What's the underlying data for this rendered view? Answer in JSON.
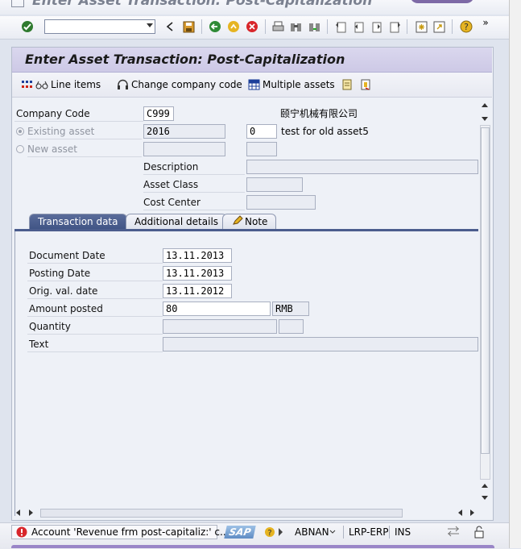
{
  "window": {
    "title": "Enter Asset Transaction: Post-Capitalization"
  },
  "toolbar": {
    "command_field_value": "",
    "icons": [
      "check-icon",
      "back-icon",
      "save-icon",
      "green-back-icon",
      "exit-icon",
      "cancel-icon",
      "print-icon",
      "find-icon",
      "find-next-icon",
      "first-page-icon",
      "prev-page-icon",
      "next-page-icon",
      "last-page-icon",
      "new-session-icon",
      "shortcut-icon",
      "help-icon",
      "more-icon"
    ]
  },
  "header": {
    "title": "Enter Asset Transaction: Post-Capitalization"
  },
  "app_toolbar": {
    "line_items": "Line items",
    "change_company_code": "Change company code",
    "multiple_assets": "Multiple assets"
  },
  "form": {
    "company_code_label": "Company Code",
    "company_code_value": "C999",
    "company_name": "颐宁机械有限公司",
    "existing_asset_label": "Existing asset",
    "existing_asset_value": "2016",
    "existing_asset_sub": "0",
    "existing_asset_text": "test for old asset5",
    "new_asset_label": "New asset",
    "new_asset_value": "",
    "new_asset_sub": "",
    "description_label": "Description",
    "description_value": "",
    "asset_class_label": "Asset Class",
    "asset_class_value": "",
    "cost_center_label": "Cost Center",
    "cost_center_value": ""
  },
  "tabs": [
    {
      "label": "Transaction data",
      "active": true
    },
    {
      "label": "Additional details",
      "active": false
    },
    {
      "label": "Note",
      "active": false
    }
  ],
  "transaction": {
    "document_date_label": "Document Date",
    "document_date_value": "13.11.2013",
    "posting_date_label": "Posting Date",
    "posting_date_value": "13.11.2013",
    "orig_val_date_label": "Orig. val. date",
    "orig_val_date_value": "13.11.2012",
    "amount_posted_label": "Amount posted",
    "amount_posted_value": "80",
    "currency_value": "RMB",
    "quantity_label": "Quantity",
    "quantity_value": "",
    "quantity_unit": "",
    "text_label": "Text",
    "text_value": ""
  },
  "status_bar": {
    "message": "Account 'Revenue frm post-capitaliz:' c...",
    "system": "SAP",
    "user": "ABNAN",
    "system_id": "LRP-ERP",
    "mode": "INS"
  },
  "colors": {
    "accent": "#4b5d8d",
    "title_bg": "#cdc9e6",
    "error": "#d8262b"
  }
}
